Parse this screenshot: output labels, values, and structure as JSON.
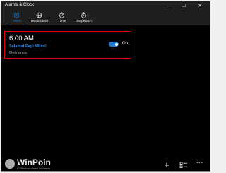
{
  "window": {
    "title": "Alarms & Clock"
  },
  "window_controls": {
    "minimize": "—",
    "maximize": "☐",
    "close": "✕"
  },
  "tabs": [
    {
      "label": "Alarm",
      "icon": "alarm-clock-icon",
      "active": true
    },
    {
      "label": "World Clock",
      "icon": "globe-icon",
      "active": false
    },
    {
      "label": "Timer",
      "icon": "timer-icon",
      "active": false
    },
    {
      "label": "Stopwatch",
      "icon": "stopwatch-icon",
      "active": false
    }
  ],
  "alarm": {
    "time": "6:00 AM",
    "name": "Selamat Pagi Mbini!",
    "repeat": "Only once",
    "toggle_state": "On",
    "enabled": true
  },
  "command_bar": {
    "add_icon": "plus-icon",
    "select_icon": "select-icon",
    "more_icon": "more-icon",
    "add_glyph": "+",
    "more_glyph": "···"
  },
  "watermark": {
    "name": "WinPoin",
    "tagline": "#1 Windows Portal Indonesia"
  },
  "colors": {
    "accent": "#1e7ad6",
    "highlight_border": "#e00000",
    "background": "#000000"
  }
}
